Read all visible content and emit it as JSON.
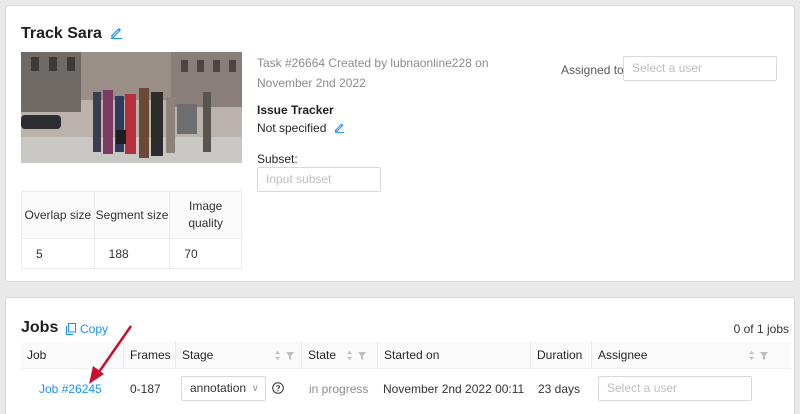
{
  "task": {
    "title": "Track Sara",
    "meta": "Task #26664 Created by lubnaonline228 on November 2nd 2022",
    "issue_tracker_label": "Issue Tracker",
    "issue_tracker_value": "Not specified",
    "subset_label": "Subset:",
    "subset_placeholder": "Input subset",
    "assigned_label": "Assigned to",
    "assignee_placeholder": "Select a user",
    "params": {
      "headers": [
        "Overlap size",
        "Segment size",
        "Image quality"
      ],
      "values": [
        "5",
        "188",
        "70"
      ]
    }
  },
  "jobs": {
    "title": "Jobs",
    "copy_label": "Copy",
    "count": "0 of 1 jobs",
    "columns": [
      "Job",
      "Frames",
      "Stage",
      "State",
      "Started on",
      "Duration",
      "Assignee"
    ],
    "rows": [
      {
        "job": "Job #26245",
        "frames": "0-187",
        "stage": "annotation",
        "state": "in progress",
        "started_on": "November 2nd 2022 00:11",
        "duration": "23 days",
        "assignee_placeholder": "Select a user"
      }
    ]
  },
  "colors": {
    "accent": "#1890ff",
    "annotation_arrow": "#c8102e"
  }
}
